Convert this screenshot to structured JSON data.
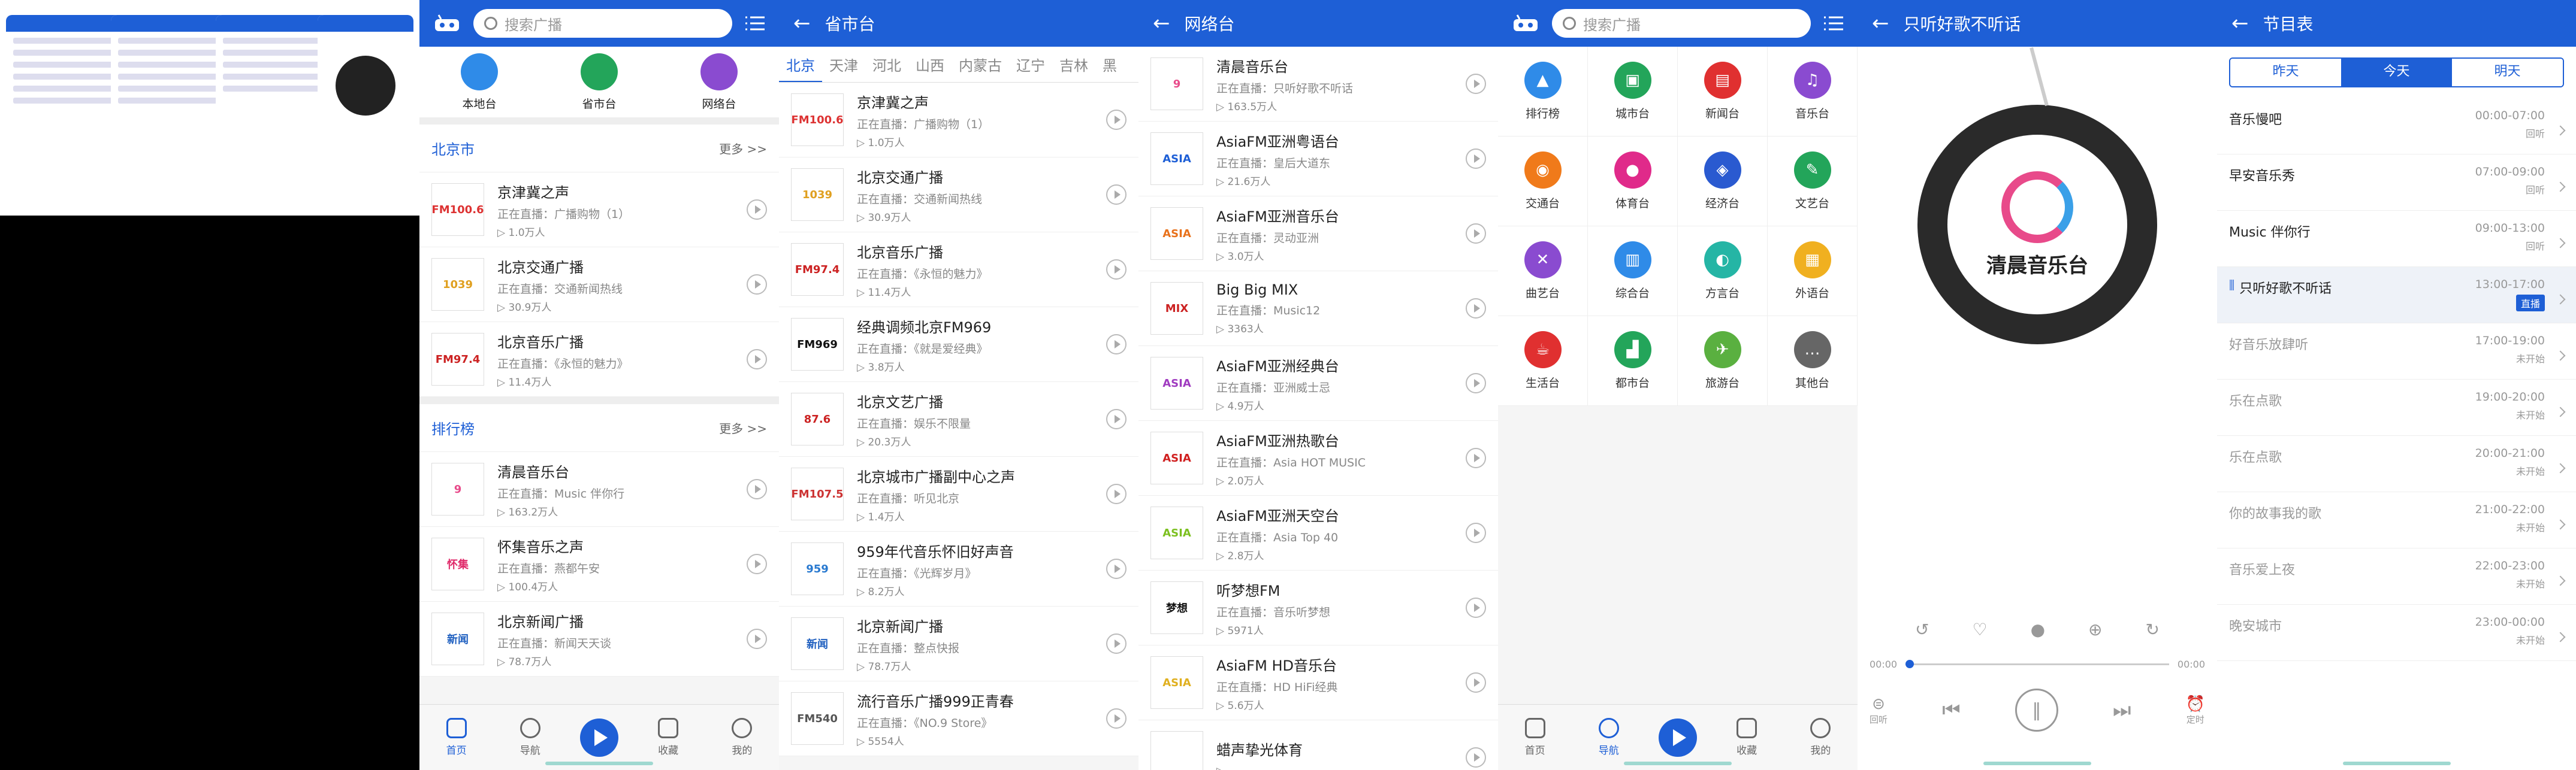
{
  "search_placeholder": "搜索广播",
  "home": {
    "quick": [
      {
        "label": "本地台",
        "color": "#2f8be8"
      },
      {
        "label": "省市台",
        "color": "#23a55a"
      },
      {
        "label": "网络台",
        "color": "#8a4bd0"
      }
    ],
    "sec1": {
      "title": "北京市",
      "more": "更多 >>"
    },
    "beijing": [
      {
        "name": "京津冀之声",
        "sub": "正在直播：广播购物（1）",
        "count": "1.0万人",
        "logo": "FM100.6",
        "logo_color": "#d33"
      },
      {
        "name": "北京交通广播",
        "sub": "正在直播：交通新闻热线",
        "count": "30.9万人",
        "logo": "1039",
        "logo_color": "#e0a020"
      },
      {
        "name": "北京音乐广播",
        "sub": "正在直播：《永恒的魅力》",
        "count": "11.4万人",
        "logo": "FM97.4",
        "logo_color": "#c22"
      }
    ],
    "sec2": {
      "title": "排行榜",
      "more": "更多 >>"
    },
    "rank": [
      {
        "name": "清晨音乐台",
        "sub": "正在直播：Music 伴你行",
        "count": "163.2万人",
        "logo": "9",
        "logo_color": "#e84a8a"
      },
      {
        "name": "怀集音乐之声",
        "sub": "正在直播：燕都午安",
        "count": "100.4万人",
        "logo": "怀集",
        "logo_color": "#e02a6a"
      },
      {
        "name": "北京新闻广播",
        "sub": "正在直播：新闻天天谈",
        "count": "78.7万人",
        "logo": "新闻",
        "logo_color": "#2060c0"
      }
    ],
    "tabbar": [
      "首页",
      "导航",
      "收藏",
      "我的"
    ]
  },
  "province": {
    "title": "省市台",
    "tabs": [
      "北京",
      "天津",
      "河北",
      "山西",
      "内蒙古",
      "辽宁",
      "吉林",
      "黑"
    ],
    "items": [
      {
        "name": "京津冀之声",
        "sub": "正在直播：广播购物（1）",
        "count": "1.0万人",
        "logo": "FM100.6",
        "logo_color": "#d33"
      },
      {
        "name": "北京交通广播",
        "sub": "正在直播：交通新闻热线",
        "count": "30.9万人",
        "logo": "1039",
        "logo_color": "#e0a020"
      },
      {
        "name": "北京音乐广播",
        "sub": "正在直播：《永恒的魅力》",
        "count": "11.4万人",
        "logo": "FM97.4",
        "logo_color": "#c22"
      },
      {
        "name": "经典调频北京FM969",
        "sub": "正在直播：《就是爱经典》",
        "count": "3.8万人",
        "logo": "FM969",
        "logo_color": "#111"
      },
      {
        "name": "北京文艺广播",
        "sub": "正在直播：娱乐不限量",
        "count": "20.3万人",
        "logo": "87.6",
        "logo_color": "#c22"
      },
      {
        "name": "北京城市广播副中心之声",
        "sub": "正在直播：听见北京",
        "count": "1.4万人",
        "logo": "FM107.5",
        "logo_color": "#c33"
      },
      {
        "name": "959年代音乐怀旧好声音",
        "sub": "正在直播：《光辉岁月》",
        "count": "8.2万人",
        "logo": "959",
        "logo_color": "#2a7ad0"
      },
      {
        "name": "北京新闻广播",
        "sub": "正在直播：整点快报",
        "count": "78.7万人",
        "logo": "新闻",
        "logo_color": "#2060c0"
      },
      {
        "name": "流行音乐广播999正青春",
        "sub": "正在直播：《NO.9 Store》",
        "count": "5554人",
        "logo": "FM540",
        "logo_color": "#555"
      }
    ]
  },
  "network": {
    "title": "网络台",
    "items": [
      {
        "name": "清晨音乐台",
        "sub": "正在直播：只听好歌不听话",
        "count": "163.5万人",
        "logo": "9",
        "logo_color": "#e84a8a"
      },
      {
        "name": "AsiaFM亚洲粤语台",
        "sub": "正在直播：皇后大道东",
        "count": "21.6万人",
        "logo": "ASIA",
        "logo_color": "#1e5fd6"
      },
      {
        "name": "AsiaFM亚洲音乐台",
        "sub": "正在直播：灵动亚洲",
        "count": "3.0万人",
        "logo": "ASIA",
        "logo_color": "#e8721c"
      },
      {
        "name": "Big Big MIX",
        "sub": "正在直播：Music12",
        "count": "3363人",
        "logo": "MIX",
        "logo_color": "#c22"
      },
      {
        "name": "AsiaFM亚洲经典台",
        "sub": "正在直播：亚洲威士忌",
        "count": "4.9万人",
        "logo": "ASIA",
        "logo_color": "#a03cc0"
      },
      {
        "name": "AsiaFM亚洲热歌台",
        "sub": "正在直播：Asia HOT MUSIC",
        "count": "2.0万人",
        "logo": "ASIA",
        "logo_color": "#d02020"
      },
      {
        "name": "AsiaFM亚洲天空台",
        "sub": "正在直播：Asia Top 40",
        "count": "2.8万人",
        "logo": "ASIA",
        "logo_color": "#7cc020"
      },
      {
        "name": "听梦想FM",
        "sub": "正在直播：音乐听梦想",
        "count": "5971人",
        "logo": "梦想",
        "logo_color": "#111"
      },
      {
        "name": "AsiaFM HD音乐台",
        "sub": "正在直播：HD HiFi经典",
        "count": "5.6万人",
        "logo": "ASIA",
        "logo_color": "#e0b020"
      },
      {
        "name": "蜡声挚光体育",
        "sub": "",
        "count": "",
        "logo": "",
        "logo_color": "#e84a8a"
      }
    ]
  },
  "categories": {
    "items": [
      {
        "label": "排行榜",
        "color": "#2f8be8",
        "glyph": "▲"
      },
      {
        "label": "城市台",
        "color": "#23a55a",
        "glyph": "▣"
      },
      {
        "label": "新闻台",
        "color": "#e03030",
        "glyph": "▤"
      },
      {
        "label": "音乐台",
        "color": "#8a4bd0",
        "glyph": "♫"
      },
      {
        "label": "交通台",
        "color": "#f07a1a",
        "glyph": "◉"
      },
      {
        "label": "体育台",
        "color": "#e02a8a",
        "glyph": "●"
      },
      {
        "label": "经济台",
        "color": "#2a5ad0",
        "glyph": "◈"
      },
      {
        "label": "文艺台",
        "color": "#23a55a",
        "glyph": "✎"
      },
      {
        "label": "曲艺台",
        "color": "#8a4bd0",
        "glyph": "✕"
      },
      {
        "label": "综合台",
        "color": "#2f8be8",
        "glyph": "▥"
      },
      {
        "label": "方言台",
        "color": "#25b5a5",
        "glyph": "◐"
      },
      {
        "label": "外语台",
        "color": "#f0b020",
        "glyph": "▦"
      },
      {
        "label": "生活台",
        "color": "#e03030",
        "glyph": "☕"
      },
      {
        "label": "都市台",
        "color": "#23a55a",
        "glyph": "▟"
      },
      {
        "label": "旅游台",
        "color": "#5ab040",
        "glyph": "✈"
      },
      {
        "label": "其他台",
        "color": "#666666",
        "glyph": "…"
      }
    ]
  },
  "player": {
    "title": "只听好歌不听话",
    "logo_text": "清晨音乐台",
    "time_start": "00:00",
    "time_end": "00:00",
    "left_label": "回听",
    "right_label": "定时"
  },
  "schedule": {
    "title": "节目表",
    "tabs": [
      "昨天",
      "今天",
      "明天"
    ],
    "items": [
      {
        "name": "音乐慢吧",
        "time": "00:00-07:00",
        "status": "回听",
        "state": "past"
      },
      {
        "name": "早安音乐秀",
        "time": "07:00-09:00",
        "status": "回听",
        "state": "past"
      },
      {
        "name": "Music 伴你行",
        "time": "09:00-13:00",
        "status": "回听",
        "state": "past"
      },
      {
        "name": "只听好歌不听话",
        "time": "13:00-17:00",
        "status": "直播",
        "state": "live"
      },
      {
        "name": "好音乐放肆听",
        "time": "17:00-19:00",
        "status": "未开始",
        "state": "future"
      },
      {
        "name": "乐在点歌",
        "time": "19:00-20:00",
        "status": "未开始",
        "state": "future"
      },
      {
        "name": "乐在点歌",
        "time": "20:00-21:00",
        "status": "未开始",
        "state": "future"
      },
      {
        "name": "你的故事我的歌",
        "time": "21:00-22:00",
        "status": "未开始",
        "state": "future"
      },
      {
        "name": "音乐爱上夜",
        "time": "22:00-23:00",
        "status": "未开始",
        "state": "future"
      },
      {
        "name": "晚安城市",
        "time": "23:00-00:00",
        "status": "未开始",
        "state": "future"
      }
    ]
  }
}
